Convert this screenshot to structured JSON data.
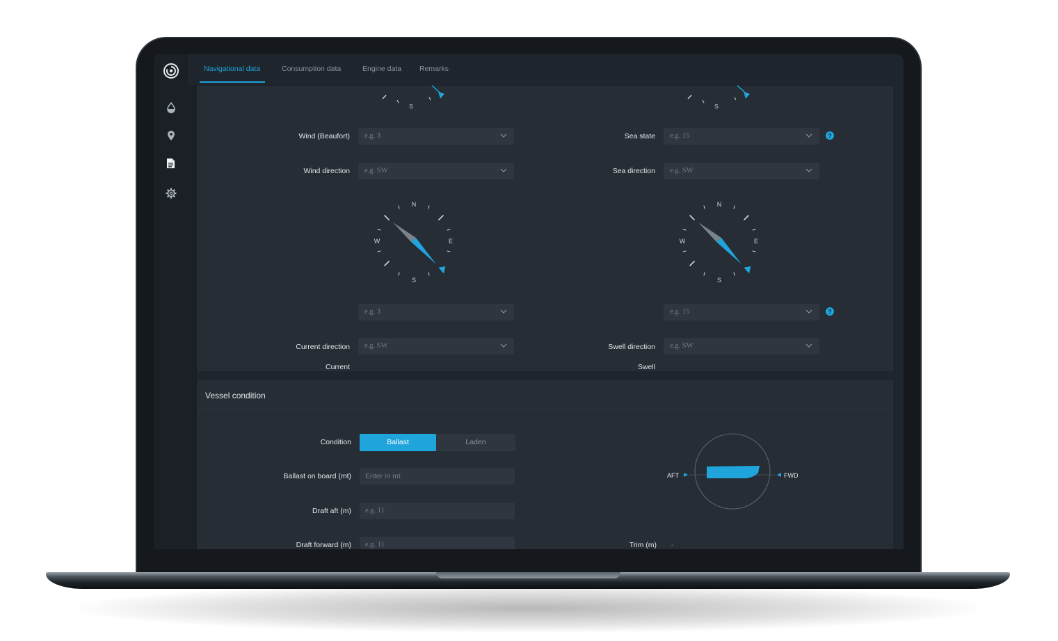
{
  "app": {
    "logo": "spiral-logo"
  },
  "sidebar": {
    "items": [
      {
        "icon": "fuel-drop-icon"
      },
      {
        "icon": "location-pin-icon"
      },
      {
        "icon": "document-icon"
      },
      {
        "icon": "gear-icon"
      }
    ]
  },
  "tabs": [
    {
      "label": "Navigational data",
      "active": true
    },
    {
      "label": "Consumption data",
      "active": false
    },
    {
      "label": "Engine data",
      "active": false
    },
    {
      "label": "Remarks",
      "active": false
    }
  ],
  "compass_labels": {
    "n": "N",
    "e": "E",
    "s": "S",
    "w": "W"
  },
  "navigation": {
    "wind_beaufort": {
      "label": "Wind (Beaufort)",
      "placeholder": "e.g. 3"
    },
    "wind_direction": {
      "label": "Wind direction",
      "placeholder": "e.g. SW"
    },
    "current": {
      "label": "Current",
      "placeholder": "e.g. 3"
    },
    "current_direction": {
      "label": "Current  direction",
      "placeholder": "e.g. SW"
    },
    "sea_state": {
      "label": "Sea state",
      "placeholder": "e.g. 15"
    },
    "sea_direction": {
      "label": "Sea direction",
      "placeholder": "e.g. SW"
    },
    "swell": {
      "label": "Swell",
      "placeholder": "e.g. 15"
    },
    "swell_direction": {
      "label": "Swell direction",
      "placeholder": "e.g. SW"
    },
    "info_glyph": "?"
  },
  "vessel": {
    "title": "Vessel condition",
    "condition": {
      "label": "Condition",
      "options": [
        "Ballast",
        "Laden"
      ],
      "selected": "Ballast"
    },
    "ballast_on_board": {
      "label": "Ballast on board (mt)",
      "placeholder": "Enter in mt"
    },
    "draft_aft": {
      "label": "Draft aft (m)",
      "placeholder": "e.g. 11"
    },
    "draft_forward": {
      "label": "Draft forward (m)",
      "placeholder": "e.g. 11"
    },
    "trim": {
      "label": "Trim (m)",
      "value": "-"
    },
    "diagram": {
      "aft": "AFT",
      "fwd": "FWD"
    }
  },
  "colors": {
    "accent": "#1fa4dc",
    "panel": "#262d35",
    "field": "#2f363f",
    "background": "#1f252c"
  }
}
